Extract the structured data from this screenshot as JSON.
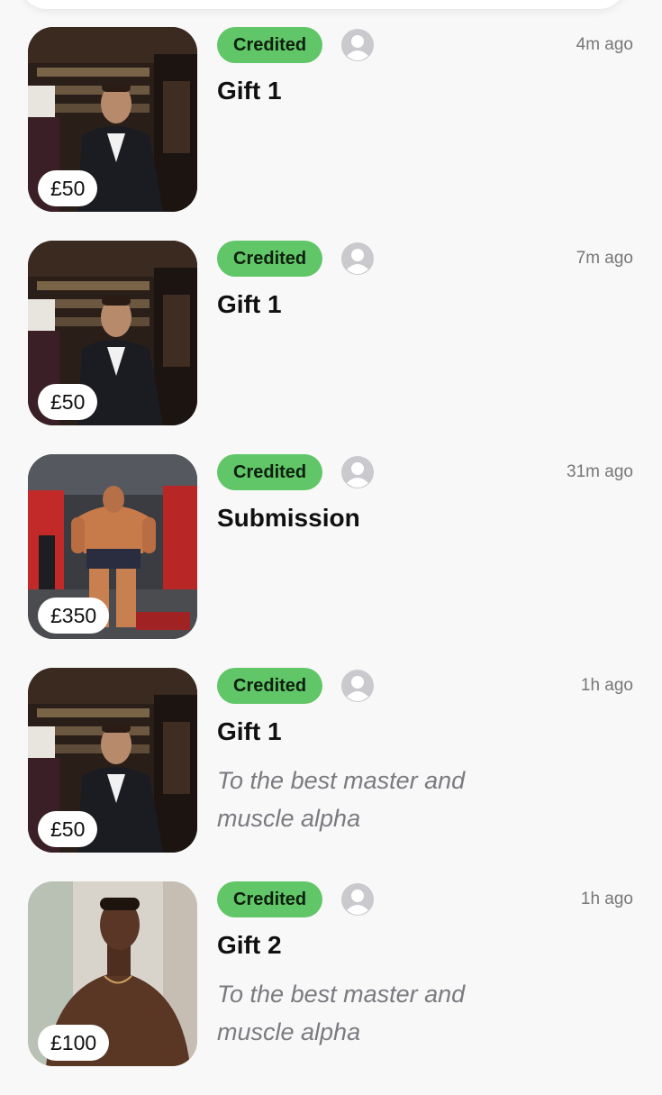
{
  "feed": {
    "items": [
      {
        "status": "Credited",
        "time": "4m ago",
        "title": "Gift 1",
        "price": "£50",
        "message": "",
        "photo": "man-in-suit-bar-photo"
      },
      {
        "status": "Credited",
        "time": "7m ago",
        "title": "Gift 1",
        "price": "£50",
        "message": "",
        "photo": "man-in-suit-bar-photo"
      },
      {
        "status": "Credited",
        "time": "31m ago",
        "title": "Submission",
        "price": "£350",
        "message": "",
        "photo": "bodybuilder-gym-photo"
      },
      {
        "status": "Credited",
        "time": "1h ago",
        "title": "Gift 1",
        "price": "£50",
        "message": "To the best master and muscle alpha",
        "photo": "man-in-suit-bar-photo"
      },
      {
        "status": "Credited",
        "time": "1h ago",
        "title": "Gift 2",
        "price": "£100",
        "message": "To the best master and muscle alpha",
        "photo": "shirtless-man-photo"
      }
    ]
  },
  "colors": {
    "badge": "#61c667",
    "background": "#f8f8f8",
    "muted_text": "#7a7a80"
  }
}
